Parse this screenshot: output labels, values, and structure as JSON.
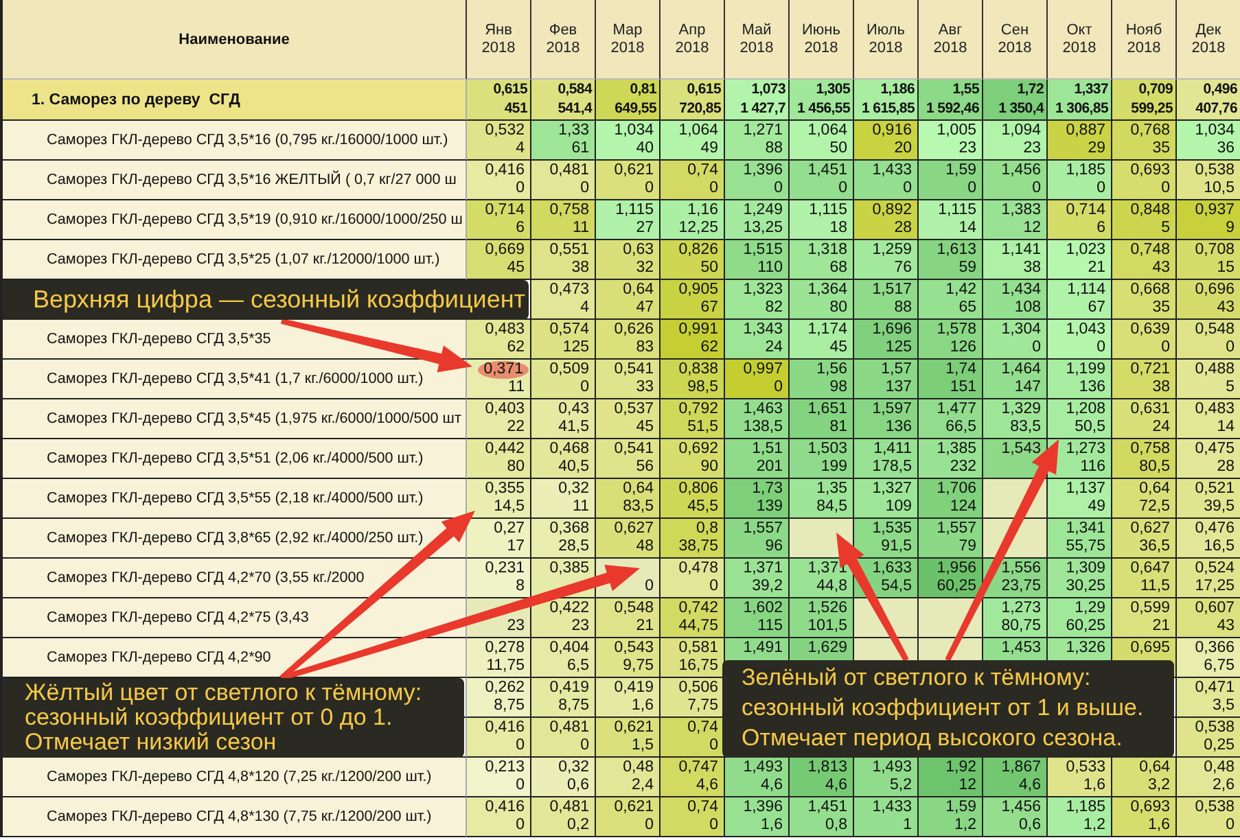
{
  "table": {
    "name_header": "Наименование",
    "months": [
      {
        "month": "Янв",
        "year": "2018"
      },
      {
        "month": "Фев",
        "year": "2018"
      },
      {
        "month": "Мар",
        "year": "2018"
      },
      {
        "month": "Апр",
        "year": "2018"
      },
      {
        "month": "Май",
        "year": "2018"
      },
      {
        "month": "Июнь",
        "year": "2018"
      },
      {
        "month": "Июль",
        "year": "2018"
      },
      {
        "month": "Авг",
        "year": "2018"
      },
      {
        "month": "Сен",
        "year": "2018"
      },
      {
        "month": "Окт",
        "year": "2018"
      },
      {
        "month": "Нояб",
        "year": "2018"
      },
      {
        "month": "Дек",
        "year": "2018"
      }
    ],
    "group": {
      "name": "1. Саморез по дереву  СГД",
      "cells": [
        [
          "0,615",
          "451"
        ],
        [
          "0,584",
          "541,4"
        ],
        [
          "0,81",
          "649,55"
        ],
        [
          "0,615",
          "720,85"
        ],
        [
          "1,073",
          "1 427,7"
        ],
        [
          "1,305",
          "1 456,55"
        ],
        [
          "1,186",
          "1 615,85"
        ],
        [
          "1,55",
          "1 592,46"
        ],
        [
          "1,72",
          "1 350,4"
        ],
        [
          "1,337",
          "1 306,85"
        ],
        [
          "0,709",
          "599,25"
        ],
        [
          "0,496",
          "407,76"
        ]
      ]
    },
    "rows": [
      {
        "name": "Саморез ГКЛ-дерево СГД 3,5*16  (0,795 кг./16000/1000 шт.)",
        "cells": [
          [
            "0,532",
            "4"
          ],
          [
            "1,33",
            "61"
          ],
          [
            "1,034",
            "40"
          ],
          [
            "1,064",
            "49"
          ],
          [
            "1,271",
            "88"
          ],
          [
            "1,064",
            "50"
          ],
          [
            "0,916",
            "20"
          ],
          [
            "1,005",
            "23"
          ],
          [
            "1,094",
            "23"
          ],
          [
            "0,887",
            "29"
          ],
          [
            "0,768",
            "35"
          ],
          [
            "1,034",
            "36"
          ]
        ]
      },
      {
        "name": "Саморез ГКЛ-дерево СГД 3,5*16  ЖЕЛТЫЙ ( 0,7 кг/27 000 ш",
        "cells": [
          [
            "0,416",
            "0"
          ],
          [
            "0,481",
            "0"
          ],
          [
            "0,621",
            "0"
          ],
          [
            "0,74",
            "0"
          ],
          [
            "1,396",
            "0"
          ],
          [
            "1,451",
            "0"
          ],
          [
            "1,433",
            "0"
          ],
          [
            "1,59",
            "0"
          ],
          [
            "1,456",
            "0"
          ],
          [
            "1,185",
            "0"
          ],
          [
            "0,693",
            "0"
          ],
          [
            "0,538",
            "10,5"
          ]
        ]
      },
      {
        "name": "Саморез ГКЛ-дерево СГД 3,5*19  (0,910 кг./16000/1000/250 ш",
        "cells": [
          [
            "0,714",
            "6"
          ],
          [
            "0,758",
            "11"
          ],
          [
            "1,115",
            "27"
          ],
          [
            "1,16",
            "12,25"
          ],
          [
            "1,249",
            "13,25"
          ],
          [
            "1,115",
            "18"
          ],
          [
            "0,892",
            "28"
          ],
          [
            "1,115",
            "14"
          ],
          [
            "1,383",
            "12"
          ],
          [
            "0,714",
            "6"
          ],
          [
            "0,848",
            "5"
          ],
          [
            "0,937",
            "9"
          ]
        ]
      },
      {
        "name": "Саморез ГКЛ-дерево СГД 3,5*25 (1,07 кг./12000/1000 шт.)",
        "cells": [
          [
            "0,669",
            "45"
          ],
          [
            "0,551",
            "38"
          ],
          [
            "0,63",
            "32"
          ],
          [
            "0,826",
            "50"
          ],
          [
            "1,515",
            "110"
          ],
          [
            "1,318",
            "68"
          ],
          [
            "1,259",
            "76"
          ],
          [
            "1,613",
            "59"
          ],
          [
            "1,141",
            "38"
          ],
          [
            "1,023",
            "21"
          ],
          [
            "0,748",
            "43"
          ],
          [
            "0,708",
            "15"
          ]
        ]
      },
      {
        "cells": [
          null,
          [
            "0,473",
            "4"
          ],
          [
            "0,64",
            "47"
          ],
          [
            "0,905",
            "67"
          ],
          [
            "1,323",
            "82"
          ],
          [
            "1,364",
            "80"
          ],
          [
            "1,517",
            "88"
          ],
          [
            "1,42",
            "65"
          ],
          [
            "1,434",
            "108"
          ],
          [
            "1,114",
            "67"
          ],
          [
            "0,668",
            "35"
          ],
          [
            "0,696",
            "43"
          ]
        ]
      },
      {
        "name": "Саморез ГКЛ-дерево СГД 3,5*35",
        "cells": [
          [
            "0,483",
            "62"
          ],
          [
            "0,574",
            "125"
          ],
          [
            "0,626",
            "83"
          ],
          [
            "0,991",
            "62"
          ],
          [
            "1,343",
            "24"
          ],
          [
            "1,174",
            "45"
          ],
          [
            "1,696",
            "125"
          ],
          [
            "1,578",
            "126"
          ],
          [
            "1,304",
            "0"
          ],
          [
            "1,043",
            "0"
          ],
          [
            "0,639",
            "0"
          ],
          [
            "0,548",
            "0"
          ]
        ]
      },
      {
        "name": "Саморез ГКЛ-дерево СГД 3,5*41 (1,7 кг./6000/1000 шт.)",
        "cells": [
          [
            "0,371",
            "11",
            true
          ],
          [
            "0,509",
            "0"
          ],
          [
            "0,541",
            "33"
          ],
          [
            "0,838",
            "98,5"
          ],
          [
            "0,997",
            "0"
          ],
          [
            "1,56",
            "98"
          ],
          [
            "1,57",
            "137"
          ],
          [
            "1,74",
            "151"
          ],
          [
            "1,464",
            "147"
          ],
          [
            "1,199",
            "136"
          ],
          [
            "0,721",
            "38"
          ],
          [
            "0,488",
            "5"
          ]
        ]
      },
      {
        "name": "Саморез ГКЛ-дерево СГД 3,5*45 (1,975 кг./6000/1000/500 шт",
        "cells": [
          [
            "0,403",
            "22"
          ],
          [
            "0,43",
            "41,5"
          ],
          [
            "0,537",
            "45"
          ],
          [
            "0,792",
            "51,5"
          ],
          [
            "1,463",
            "138,5"
          ],
          [
            "1,651",
            "81"
          ],
          [
            "1,597",
            "136"
          ],
          [
            "1,477",
            "66,5"
          ],
          [
            "1,329",
            "83,5"
          ],
          [
            "1,208",
            "50,5"
          ],
          [
            "0,631",
            "24"
          ],
          [
            "0,483",
            "14"
          ]
        ]
      },
      {
        "name": "Саморез ГКЛ-дерево СГД 3,5*51 (2,06 кг./4000/500 шт.)",
        "cells": [
          [
            "0,442",
            "80"
          ],
          [
            "0,468",
            "40,5"
          ],
          [
            "0,541",
            "56"
          ],
          [
            "0,692",
            "90"
          ],
          [
            "1,51",
            "201"
          ],
          [
            "1,503",
            "199"
          ],
          [
            "1,411",
            "178,5"
          ],
          [
            "1,385",
            "232"
          ],
          [
            "1,543",
            null
          ],
          [
            "1,273",
            "116"
          ],
          [
            "0,758",
            "80,5"
          ],
          [
            "0,475",
            "28"
          ]
        ]
      },
      {
        "name": "Саморез ГКЛ-дерево СГД 3,5*55 (2,18 кг./4000/500 шт.)",
        "cells": [
          [
            "0,355",
            "14,5"
          ],
          [
            "0,32",
            "11"
          ],
          [
            "0,64",
            "83,5"
          ],
          [
            "0,806",
            "45,5"
          ],
          [
            "1,73",
            "139"
          ],
          [
            "1,35",
            "84,5"
          ],
          [
            "1,327",
            "109"
          ],
          [
            "1,706",
            "124"
          ],
          [
            null,
            null
          ],
          [
            "1,137",
            "49"
          ],
          [
            "0,64",
            "72,5"
          ],
          [
            "0,521",
            "39,5"
          ]
        ]
      },
      {
        "name": "Саморез ГКЛ-дерево СГД 3,8*65 (2,92 кг./4000/250 шт.)",
        "cells": [
          [
            "0,27",
            "17"
          ],
          [
            "0,368",
            "28,5"
          ],
          [
            "0,627",
            "48"
          ],
          [
            "0,8",
            "38,75"
          ],
          [
            "1,557",
            "96"
          ],
          [
            null,
            null
          ],
          [
            "1,535",
            "91,5"
          ],
          [
            "1,557",
            "79"
          ],
          [
            null,
            null
          ],
          [
            "1,341",
            "55,75"
          ],
          [
            "0,627",
            "36,5"
          ],
          [
            "0,476",
            "16,5"
          ]
        ]
      },
      {
        "name": "Саморез ГКЛ-дерево СГД 4,2*70 (3,55 кг./2000",
        "cells": [
          [
            "0,231",
            "8"
          ],
          [
            "0,385",
            null
          ],
          [
            null,
            "0"
          ],
          [
            "0,478",
            "0"
          ],
          [
            "1,371",
            "39,2"
          ],
          [
            "1,371",
            "44,8"
          ],
          [
            "1,633",
            "54,5"
          ],
          [
            "1,956",
            "60,25"
          ],
          [
            "1,556",
            "23,75"
          ],
          [
            "1,309",
            "30,25"
          ],
          [
            "0,647",
            "11,5"
          ],
          [
            "0,524",
            "17,25"
          ]
        ]
      },
      {
        "name": "Саморез ГКЛ-дерево СГД 4,2*75 (3,43",
        "cells": [
          [
            null,
            "23"
          ],
          [
            "0,422",
            "23"
          ],
          [
            "0,548",
            "21"
          ],
          [
            "0,742",
            "44,75"
          ],
          [
            "1,602",
            "115"
          ],
          [
            "1,526",
            "101,5"
          ],
          [
            null,
            null
          ],
          [
            null,
            null
          ],
          [
            "1,273",
            "80,75"
          ],
          [
            "1,29",
            "60,25"
          ],
          [
            "0,599",
            "21"
          ],
          [
            "0,607",
            "43"
          ]
        ]
      },
      {
        "name": "Саморез ГКЛ-дерево СГД 4,2*90",
        "cells": [
          [
            "0,278",
            "11,75"
          ],
          [
            "0,404",
            "6,5"
          ],
          [
            "0,543",
            "9,75"
          ],
          [
            "0,581",
            "16,75"
          ],
          [
            "1,491",
            null
          ],
          [
            "1,629",
            null
          ],
          [
            null,
            null
          ],
          [
            null,
            null
          ],
          [
            "1,453",
            null
          ],
          [
            "1,326",
            null
          ],
          [
            "0,695",
            null
          ],
          [
            "0,366",
            "6,75"
          ]
        ]
      },
      {
        "cells": [
          [
            "0,262",
            "8,75"
          ],
          [
            "0,419",
            "8,75"
          ],
          [
            "0,419",
            "1,6"
          ],
          [
            "0,506",
            "7,75"
          ],
          null,
          null,
          null,
          null,
          null,
          null,
          null,
          [
            "0,471",
            "3,5"
          ]
        ]
      },
      {
        "cells": [
          [
            "0,416",
            "0"
          ],
          [
            "0,481",
            "0"
          ],
          [
            "0,621",
            "1,5"
          ],
          [
            "0,74",
            "0"
          ],
          null,
          null,
          null,
          null,
          null,
          null,
          null,
          [
            "0,538",
            "0,25"
          ]
        ]
      },
      {
        "name": "Саморез ГКЛ-дерево СГД 4,8*120 (7,25 кг./1200/200 шт.)",
        "cells": [
          [
            "0,213",
            "0"
          ],
          [
            "0,32",
            "0,6"
          ],
          [
            "0,48",
            "2,4"
          ],
          [
            "0,747",
            "4,6"
          ],
          [
            "1,493",
            "4,6"
          ],
          [
            "1,813",
            "4,6"
          ],
          [
            "1,493",
            "5,2"
          ],
          [
            "1,92",
            "12"
          ],
          [
            "1,867",
            "4,6"
          ],
          [
            "0,533",
            "1,6"
          ],
          [
            "0,64",
            "3,2"
          ],
          [
            "0,48",
            "2,6"
          ]
        ]
      },
      {
        "name": "Саморез ГКЛ-дерево СГД 4,8*130 (7,75 кг./1200/200 шт.)",
        "cells": [
          [
            "0,416",
            "0"
          ],
          [
            "0,481",
            "0,2"
          ],
          [
            "0,621",
            "0"
          ],
          [
            "0,74",
            "0"
          ],
          [
            "1,396",
            "1,6"
          ],
          [
            "1,451",
            "0,8"
          ],
          [
            "1,433",
            "1"
          ],
          [
            "1,59",
            "1,2"
          ],
          [
            "1,456",
            "0,6"
          ],
          [
            "1,185",
            "1,2"
          ],
          [
            "0,693",
            "1,6"
          ],
          [
            "0,538",
            "0"
          ]
        ]
      }
    ]
  },
  "annotations": [
    {
      "lines": [
        "Верхняя цифра — сезонный коэффициент"
      ]
    },
    {
      "lines": [
        "Жёлтый цвет от светлого к тёмному:",
        "сезонный коэффициент от 0 до 1.",
        "Отмечает низкий сезон"
      ]
    },
    {
      "lines": [
        "Зелёный от светлого к тёмному:",
        "сезонный коэффициент от 1 и выше.",
        "Отмечает период высокого сезона."
      ]
    }
  ]
}
